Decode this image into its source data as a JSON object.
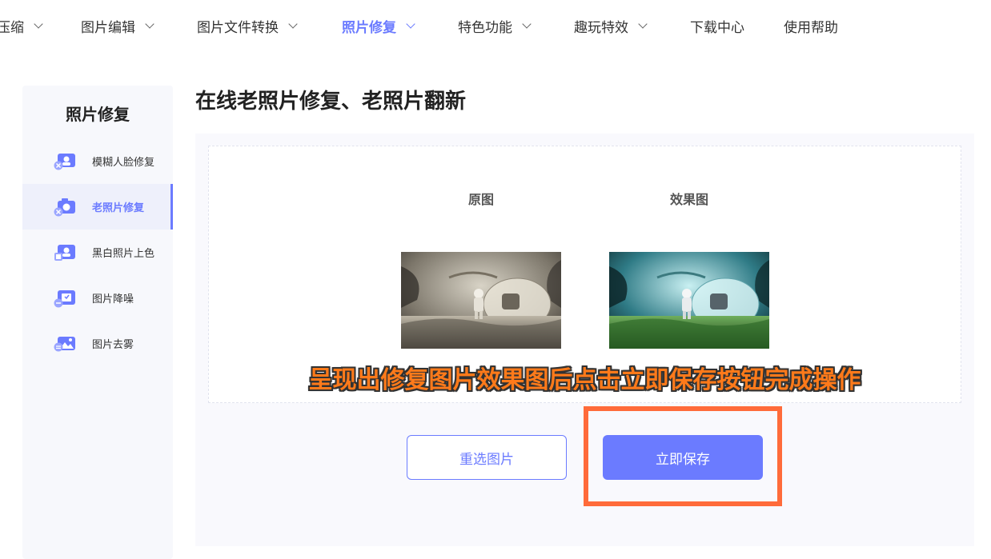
{
  "nav": {
    "items": [
      {
        "label": "压缩"
      },
      {
        "label": "图片编辑"
      },
      {
        "label": "图片文件转换"
      },
      {
        "label": "照片修复"
      },
      {
        "label": "特色功能"
      },
      {
        "label": "趣玩特效"
      },
      {
        "label": "下载中心"
      },
      {
        "label": "使用帮助"
      }
    ],
    "active_index": 3
  },
  "sidebar": {
    "title": "照片修复",
    "items": [
      {
        "label": "模糊人脸修复",
        "icon": "face-repair-icon"
      },
      {
        "label": "老照片修复",
        "icon": "camera-repair-icon"
      },
      {
        "label": "黑白照片上色",
        "icon": "colorize-icon"
      },
      {
        "label": "图片降噪",
        "icon": "denoise-icon"
      },
      {
        "label": "图片去雾",
        "icon": "dehaze-icon"
      }
    ],
    "active_index": 1
  },
  "main": {
    "title": "在线老照片修复、老照片翻新",
    "original_label": "原图",
    "result_label": "效果图",
    "caption": "呈现出修复图片效果图后点击立即保存按钮完成操作",
    "reselect_button": "重选图片",
    "save_button": "立即保存"
  },
  "colors": {
    "accent": "#6b7bff",
    "caption": "#ff7a1a",
    "highlight": "#ff6b3a"
  }
}
